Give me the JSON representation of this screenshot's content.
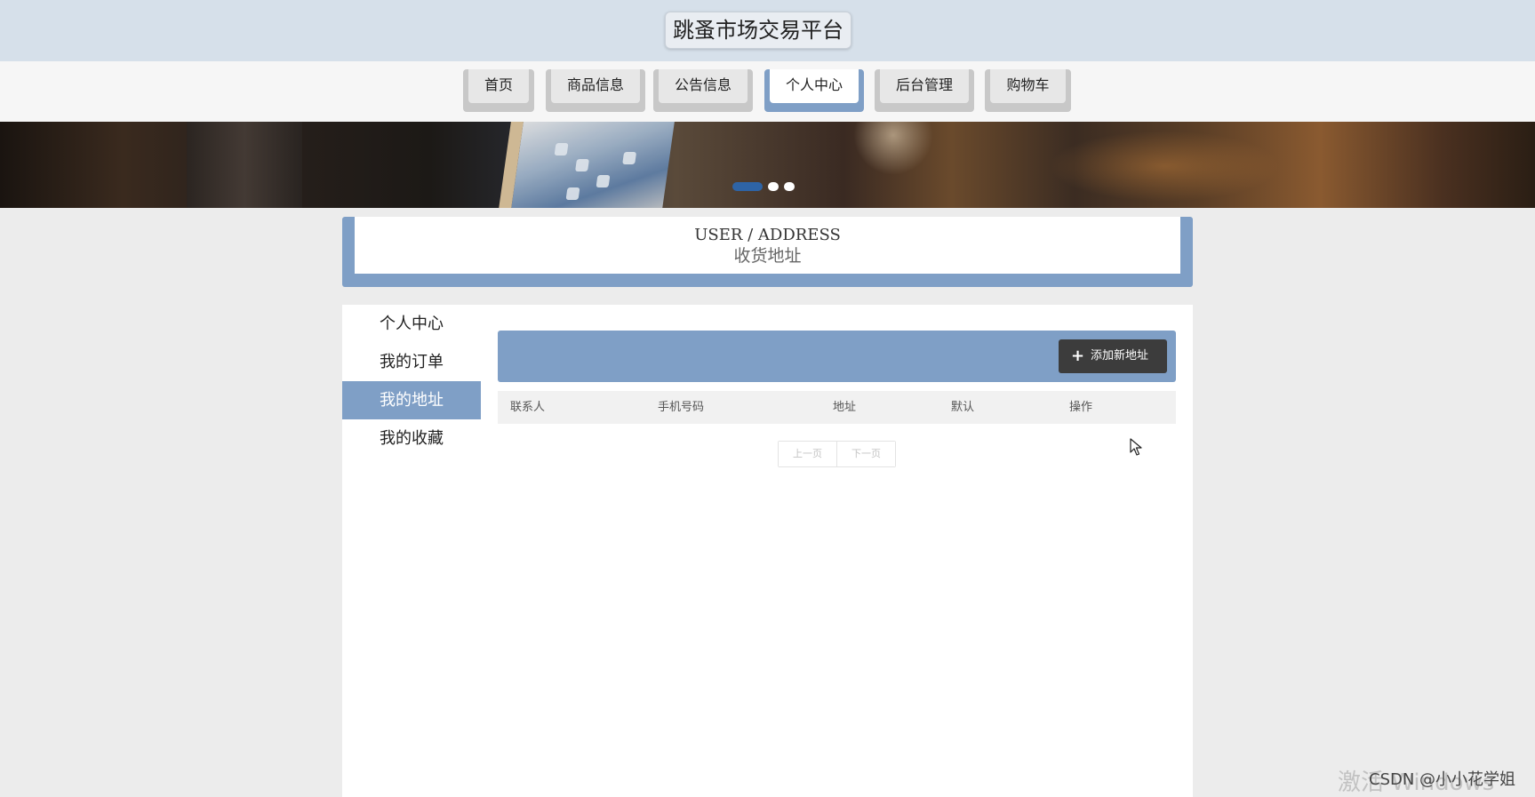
{
  "header": {
    "title": "跳蚤市场交易平台"
  },
  "nav": {
    "items": [
      {
        "label": "首页"
      },
      {
        "label": "商品信息"
      },
      {
        "label": "公告信息"
      },
      {
        "label": "个人中心"
      },
      {
        "label": "后台管理"
      },
      {
        "label": "购物车"
      }
    ],
    "active_index": 3
  },
  "banner": {
    "slides": 3,
    "active_slide": 1
  },
  "section": {
    "title_en": "USER / ADDRESS",
    "title_cn": "收货地址"
  },
  "sidebar": {
    "items": [
      {
        "label": "个人中心"
      },
      {
        "label": "我的订单"
      },
      {
        "label": "我的地址"
      },
      {
        "label": "我的收藏"
      }
    ],
    "active_index": 2
  },
  "toolbar": {
    "add_label": "添加新地址",
    "add_icon": "plus-icon"
  },
  "table": {
    "columns": [
      "联系人",
      "手机号码",
      "地址",
      "默认",
      "操作"
    ],
    "rows": []
  },
  "pager": {
    "prev_label": "上一页",
    "next_label": "下一页"
  },
  "watermarks": {
    "activate_windows": "激活 Windows",
    "csdn": "CSDN @小小花学姐"
  },
  "colors": {
    "accent": "#7f9fc6",
    "header_bg": "#d6e0ea",
    "dark_button": "#3c3c3c",
    "dot_active": "#2e64a6"
  }
}
